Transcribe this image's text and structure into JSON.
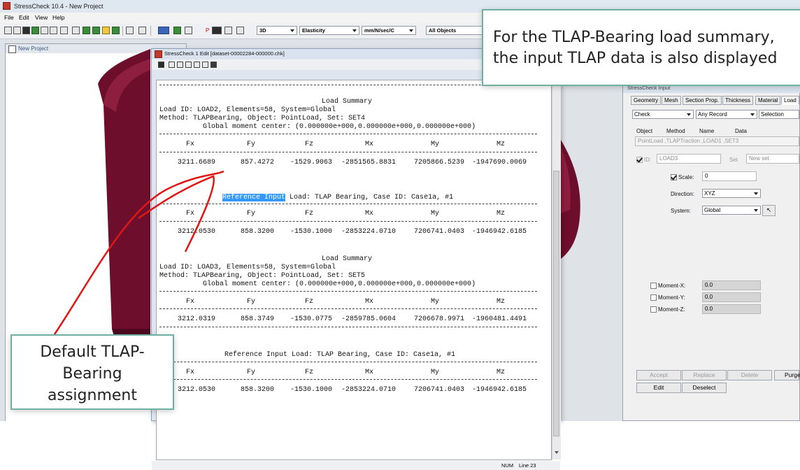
{
  "app": {
    "title": "StressCheck 10.4 - New Project",
    "menu": [
      "File",
      "Edit",
      "View",
      "Help"
    ]
  },
  "toolbar": {
    "view_mode": "3D",
    "analysis_type": "Elasticity",
    "units": "mm/N/sec/C",
    "filter": "All Objects",
    "pointer_label": "P"
  },
  "project_window": {
    "title": "New Project"
  },
  "editor": {
    "title": "StressCheck 1 Edit [dataset-00002284-000000.chk]",
    "status_num": "NUM",
    "status_line": "Line 23",
    "blocks": {
      "b1": {
        "title": "Load Summary",
        "id_line": "Load ID: LOAD2, Elements=58, System=Global",
        "method_line": "Method: TLAPBearing, Object: PointLoad, Set: SET4",
        "moment_line": "Global moment center: (0.000000e+000,0.000000e+000,0.000000e+000)",
        "headers": [
          "Fx",
          "Fy",
          "Fz",
          "Mx",
          "My",
          "Mz"
        ],
        "values": [
          "3211.6689",
          "857.4272",
          "-1529.9063",
          "-2851565.8831",
          "7205866.5239",
          "-1947690.0069"
        ]
      },
      "b2": {
        "ref_highlight": "Reference Input",
        "ref_rest": "Load: TLAP Bearing, Case ID: Case1a, #1",
        "headers": [
          "Fx",
          "Fy",
          "Fz",
          "Mx",
          "My",
          "Mz"
        ],
        "values": [
          "3212.0530",
          "858.3200",
          "-1530.1000",
          "-2853224.0710",
          "7206741.0403",
          "-1946942.6185"
        ]
      },
      "b3": {
        "title": "Load Summary",
        "id_line": "Load ID: LOAD3, Elements=58, System=Global",
        "method_line": "Method: TLAPBearing, Object: PointLoad, Set: SET5",
        "moment_line": "Global moment center: (0.000000e+000,0.000000e+000,0.000000e+000)",
        "headers": [
          "Fx",
          "Fy",
          "Fz",
          "Mx",
          "My",
          "Mz"
        ],
        "values": [
          "3212.0319",
          "858.3749",
          "-1530.0775",
          "-2859785.0604",
          "7206678.9971",
          "-1960481.4491"
        ]
      },
      "b4": {
        "ref_line": "Reference Input Load: TLAP Bearing, Case ID: Case1a, #1",
        "headers": [
          "Fx",
          "Fy",
          "Fz",
          "Mx",
          "My",
          "Mz"
        ],
        "values": [
          "3212.0530",
          "858.3200",
          "-1530.1000",
          "-2853224.0710",
          "7206741.0403",
          "-1946942.6185"
        ]
      }
    }
  },
  "input_panel": {
    "title": "StressCheck Input",
    "tabs": [
      "Geometry",
      "Mesh",
      "Section Prop.",
      "Thickness",
      "Material",
      "Load"
    ],
    "mode": "Check",
    "record": "Any Record",
    "selection": "Selection",
    "columns": [
      "Object",
      "Method",
      "Name",
      "Data"
    ],
    "record_row": [
      "PointLoad",
      "TLAPTraction",
      "LOAD1",
      "SET3"
    ],
    "id_label": "ID:",
    "id_value": "LOAD3",
    "set_label": "Set",
    "set_value": "New set",
    "scale_label": "Scale:",
    "scale_value": "0",
    "direction_label": "Direction:",
    "direction_value": "XYZ",
    "system_label": "System:",
    "system_value": "Global",
    "moments": [
      {
        "label": "Moment-X:",
        "value": "0.0"
      },
      {
        "label": "Moment-Y:",
        "value": "0.0"
      },
      {
        "label": "Moment-Z:",
        "value": "0.0"
      }
    ],
    "buttons": {
      "accept": "Accept",
      "replace": "Replace",
      "delete": "Delete",
      "purge": "Purge",
      "edit": "Edit",
      "deselect": "Deselect"
    }
  },
  "callouts": {
    "top_line1": "For the TLAP-Bearing load summary,",
    "top_line2": "the input TLAP data is also displayed",
    "bottom": "Default TLAP-\nBearing\nassignment"
  }
}
